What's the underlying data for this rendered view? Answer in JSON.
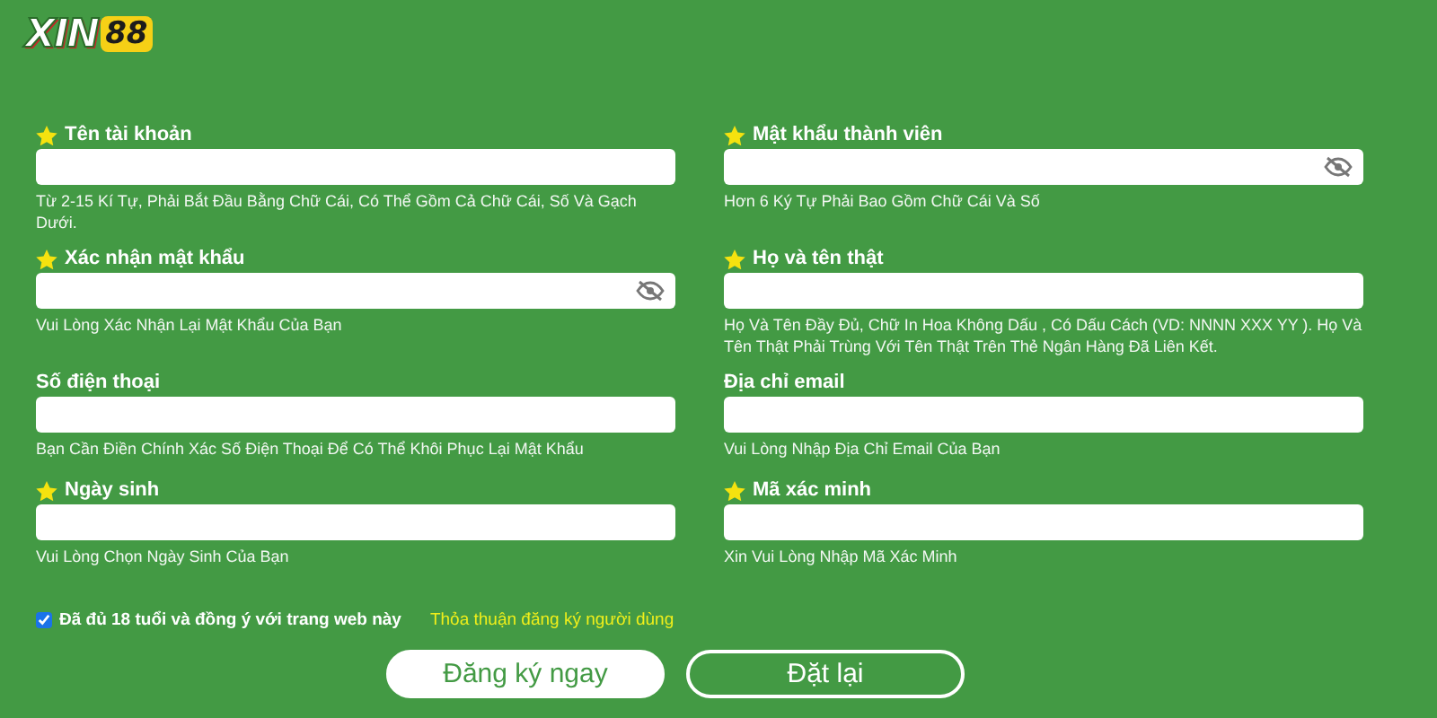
{
  "logo": {
    "text": "XIN",
    "badge": "88"
  },
  "fields": [
    {
      "label": "Tên tài khoản",
      "required": true,
      "password": false,
      "hint": "Từ 2-15 Kí Tự, Phải Bắt Đầu Bằng Chữ Cái, Có Thể Gồm Cả Chữ Cái, Số Và Gạch Dưới."
    },
    {
      "label": "Mật khẩu thành viên",
      "required": true,
      "password": true,
      "hint": "Hơn 6 Ký Tự Phải Bao Gồm Chữ Cái Và Số"
    },
    {
      "label": "Xác nhận mật khẩu",
      "required": true,
      "password": true,
      "hint": "Vui Lòng Xác Nhận Lại Mật Khẩu Của Bạn"
    },
    {
      "label": "Họ và tên thật",
      "required": true,
      "password": false,
      "hint": "Họ Và Tên Đầy Đủ, Chữ In Hoa Không Dấu , Có Dấu Cách (VD: NNNN XXX YY ). Họ Và Tên Thật Phải Trùng Với Tên Thật Trên Thẻ Ngân Hàng Đã Liên Kết."
    },
    {
      "label": "Số điện thoại",
      "required": false,
      "password": false,
      "hint": "Bạn Cần Điền Chính Xác Số Điện Thoại Để Có Thể Khôi Phục Lại Mật Khẩu"
    },
    {
      "label": "Địa chỉ email",
      "required": false,
      "password": false,
      "hint": "Vui Lòng Nhập Địa Chỉ Email Của Bạn"
    },
    {
      "label": "Ngày sinh",
      "required": true,
      "password": false,
      "hint": "Vui Lòng Chọn Ngày Sinh Của Bạn"
    },
    {
      "label": "Mã xác minh",
      "required": true,
      "password": false,
      "hint": "Xin Vui Lòng Nhập Mã Xác Minh"
    }
  ],
  "agreement": {
    "checked": true,
    "label": "Đã đủ 18 tuổi và đồng ý với trang web này",
    "link": "Thỏa thuận đăng ký người dùng"
  },
  "buttons": [
    {
      "label": "Đăng ký ngay",
      "kind": "primary"
    },
    {
      "label": "Đặt lại",
      "kind": "outline"
    }
  ]
}
